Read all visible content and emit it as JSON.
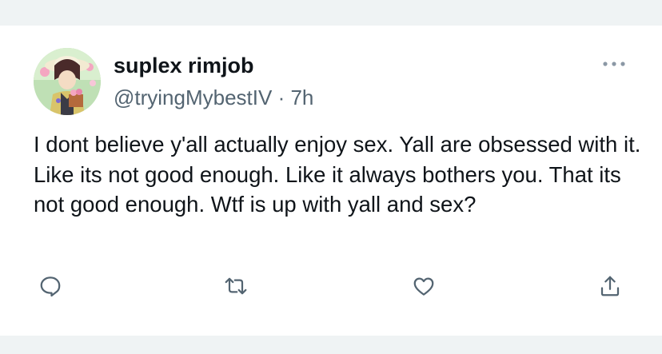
{
  "tweet": {
    "author_name": "suplex rimjob",
    "handle": "@tryingMybestIV",
    "separator": " · ",
    "time": "7h",
    "text": "I dont believe y'all actually enjoy sex. Yall are obsessed with it. Like its not good enough. Like it always bothers you. That its not good enough. Wtf is up with yall and sex?"
  },
  "icons": {
    "more": "more-dots-icon",
    "reply": "reply-icon",
    "retweet": "retweet-icon",
    "like": "like-heart-icon",
    "share": "share-icon"
  },
  "colors": {
    "text": "#0f1419",
    "secondary": "#536471",
    "page_background": "#eff3f4",
    "card_background": "#ffffff"
  }
}
